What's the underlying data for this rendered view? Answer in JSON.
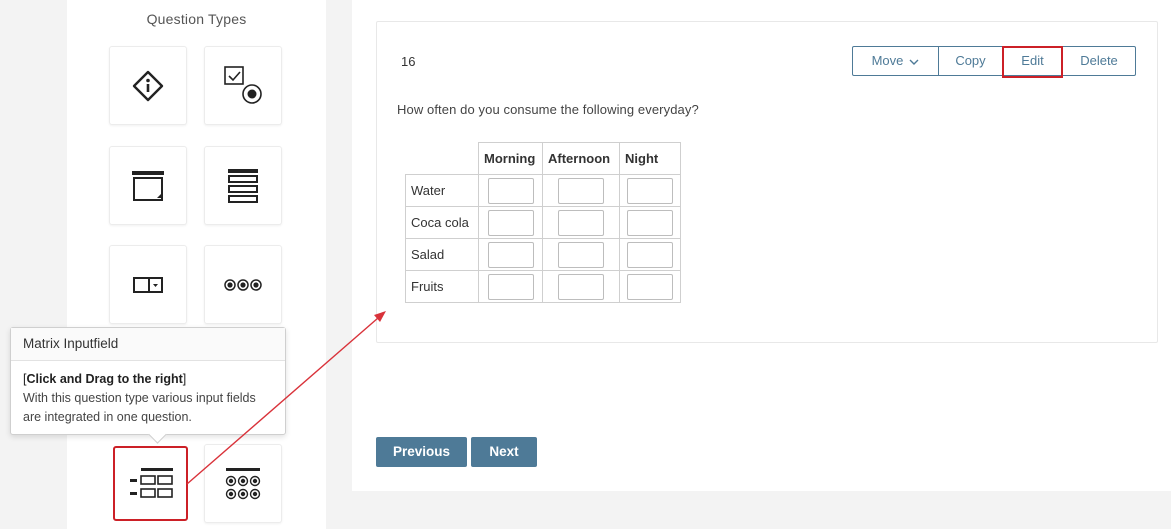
{
  "sidebar": {
    "title": "Question Types",
    "tiles": [
      {
        "icon": "info-diamond-icon"
      },
      {
        "icon": "checkbox-radio-icon"
      },
      {
        "icon": "text-area-icon"
      },
      {
        "icon": "list-rows-icon"
      },
      {
        "icon": "dropdown-icon"
      },
      {
        "icon": "radio-dots-icon"
      },
      {
        "icon": "matrix-inputfield-icon"
      },
      {
        "icon": "matrix-radio-icon"
      }
    ]
  },
  "tooltip": {
    "title": "Matrix Inputfield",
    "drag_open": "[",
    "drag_bold": "Click and Drag to the right",
    "drag_close": "]",
    "description": "With this question type various input fields are integrated in one question."
  },
  "question": {
    "number": "16",
    "text": "How often do you consume the following everyday?",
    "actions": {
      "move": "Move",
      "copy": "Copy",
      "edit": "Edit",
      "delete": "Delete"
    },
    "columns": [
      "Morning",
      "Afternoon",
      "Night"
    ],
    "rows": [
      "Water",
      "Coca cola",
      "Salad",
      "Fruits"
    ]
  },
  "navigation": {
    "previous": "Previous",
    "next": "Next"
  },
  "colors": {
    "primary": "#4e7a97",
    "highlight": "#cc2027",
    "annotation_arrow": "#d9323a"
  }
}
